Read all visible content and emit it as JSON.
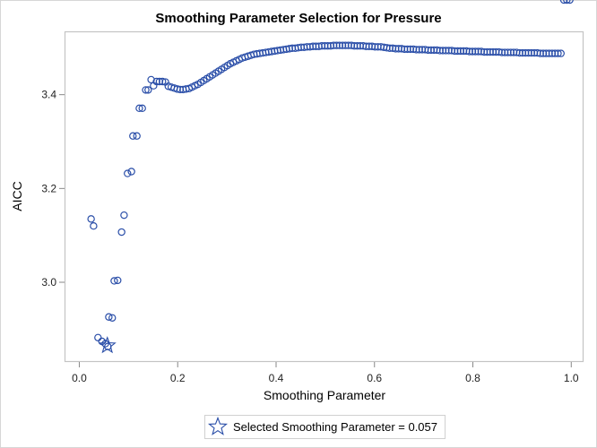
{
  "chart_data": {
    "type": "scatter",
    "title": "Smoothing Parameter Selection for Pressure",
    "xlabel": "Smoothing Parameter",
    "ylabel": "AICC",
    "xlim": [
      -0.03,
      1.025
    ],
    "ylim": [
      2.83,
      3.535
    ],
    "xticks": [
      0.0,
      0.2,
      0.4,
      0.6,
      0.8,
      1.0
    ],
    "xtick_labels": [
      "0.0",
      "0.2",
      "0.4",
      "0.6",
      "0.8",
      "1.0"
    ],
    "yticks": [
      3.0,
      3.2,
      3.4
    ],
    "ytick_labels": [
      "3.0",
      "3.2",
      "3.4"
    ],
    "grid": false,
    "marker_color": "#2a4ea8",
    "series": [
      {
        "name": "AICC",
        "marker": "circle",
        "x": [
          0.024,
          0.029,
          0.038,
          0.046,
          0.053,
          0.058,
          0.06,
          0.067,
          0.071,
          0.078,
          0.086,
          0.091,
          0.098,
          0.106,
          0.109,
          0.117,
          0.122,
          0.128,
          0.135,
          0.14,
          0.146,
          0.151,
          0.157,
          0.163,
          0.169,
          0.175,
          0.181,
          0.187,
          0.193,
          0.199,
          0.205,
          0.211,
          0.217,
          0.223,
          0.229,
          0.235,
          0.241,
          0.247,
          0.253,
          0.259,
          0.265,
          0.271,
          0.277,
          0.283,
          0.289,
          0.295,
          0.301,
          0.307,
          0.313,
          0.319,
          0.325,
          0.331,
          0.337,
          0.343,
          0.349,
          0.355,
          0.361,
          0.367,
          0.373,
          0.379,
          0.385,
          0.391,
          0.397,
          0.403,
          0.409,
          0.415,
          0.421,
          0.427,
          0.433,
          0.439,
          0.445,
          0.451,
          0.457,
          0.463,
          0.469,
          0.475,
          0.481,
          0.487,
          0.493,
          0.499,
          0.505,
          0.511,
          0.517,
          0.523,
          0.529,
          0.535,
          0.541,
          0.547,
          0.553,
          0.559,
          0.565,
          0.571,
          0.577,
          0.583,
          0.589,
          0.595,
          0.601,
          0.607,
          0.613,
          0.619,
          0.625,
          0.631,
          0.637,
          0.643,
          0.649,
          0.655,
          0.661,
          0.667,
          0.673,
          0.679,
          0.685,
          0.691,
          0.697,
          0.703,
          0.709,
          0.715,
          0.721,
          0.727,
          0.733,
          0.739,
          0.745,
          0.751,
          0.757,
          0.763,
          0.769,
          0.775,
          0.781,
          0.787,
          0.793,
          0.799,
          0.805,
          0.811,
          0.817,
          0.823,
          0.829,
          0.835,
          0.841,
          0.847,
          0.853,
          0.859,
          0.865,
          0.871,
          0.877,
          0.883,
          0.889,
          0.895,
          0.901,
          0.907,
          0.913,
          0.919,
          0.925,
          0.931,
          0.937,
          0.943,
          0.949,
          0.955,
          0.961,
          0.967,
          0.973,
          0.979,
          0.985,
          0.991,
          0.997
        ],
        "y": [
          3.135,
          3.12,
          2.882,
          2.874,
          2.869,
          2.863,
          2.926,
          2.924,
          3.003,
          3.004,
          3.107,
          3.143,
          3.232,
          3.236,
          3.312,
          3.312,
          3.371,
          3.371,
          3.41,
          3.41,
          3.432,
          3.419,
          3.428,
          3.428,
          3.428,
          3.427,
          3.418,
          3.416,
          3.414,
          3.412,
          3.411,
          3.411,
          3.412,
          3.413,
          3.416,
          3.419,
          3.422,
          3.426,
          3.43,
          3.434,
          3.438,
          3.442,
          3.446,
          3.45,
          3.454,
          3.458,
          3.462,
          3.466,
          3.469,
          3.472,
          3.475,
          3.478,
          3.48,
          3.482,
          3.484,
          3.486,
          3.487,
          3.488,
          3.489,
          3.49,
          3.491,
          3.492,
          3.493,
          3.494,
          3.495,
          3.496,
          3.497,
          3.498,
          3.499,
          3.499,
          3.5,
          3.501,
          3.501,
          3.502,
          3.502,
          3.503,
          3.503,
          3.503,
          3.504,
          3.504,
          3.504,
          3.504,
          3.505,
          3.505,
          3.505,
          3.505,
          3.505,
          3.505,
          3.505,
          3.504,
          3.504,
          3.504,
          3.504,
          3.503,
          3.503,
          3.503,
          3.502,
          3.502,
          3.502,
          3.501,
          3.5,
          3.499,
          3.499,
          3.498,
          3.498,
          3.498,
          3.497,
          3.497,
          3.497,
          3.497,
          3.496,
          3.496,
          3.496,
          3.496,
          3.495,
          3.495,
          3.495,
          3.495,
          3.494,
          3.494,
          3.494,
          3.494,
          3.494,
          3.493,
          3.493,
          3.493,
          3.493,
          3.493,
          3.492,
          3.492,
          3.492,
          3.492,
          3.492,
          3.491,
          3.491,
          3.491,
          3.491,
          3.491,
          3.491,
          3.49,
          3.49,
          3.49,
          3.49,
          3.49,
          3.49,
          3.489,
          3.489,
          3.489,
          3.489,
          3.489,
          3.489,
          3.489,
          3.488,
          3.488,
          3.488,
          3.488,
          3.488,
          3.488,
          3.488,
          3.488
        ]
      },
      {
        "name": "Selected Smoothing Parameter = 0.057",
        "marker": "star",
        "x": [
          0.057
        ],
        "y": [
          2.865
        ]
      }
    ],
    "legend": {
      "position": "bottom-center",
      "entries": [
        {
          "label": "Selected Smoothing Parameter = 0.057",
          "marker": "star-icon"
        }
      ]
    }
  }
}
